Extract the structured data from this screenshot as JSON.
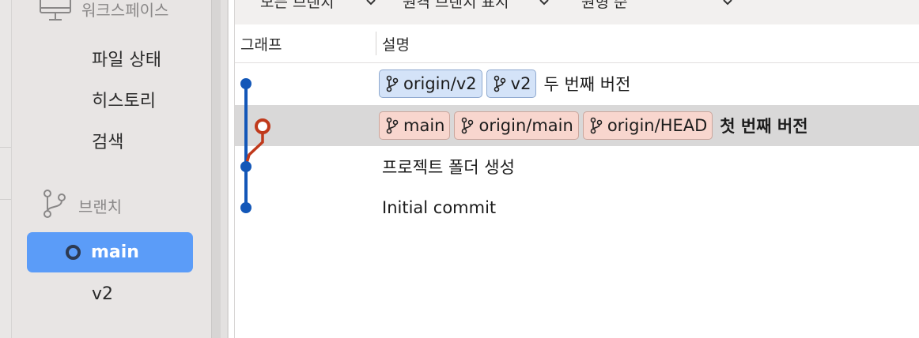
{
  "sidebar": {
    "workspace_label": "워크스페이스",
    "items": [
      {
        "label": "파일 상태"
      },
      {
        "label": "히스토리"
      },
      {
        "label": "검색"
      }
    ],
    "branches_label": "브랜치",
    "branches": [
      {
        "label": "main",
        "active": true
      },
      {
        "label": "v2",
        "active": false
      }
    ]
  },
  "toolbar": {
    "branch_filter": "모든 브랜치",
    "remote_filter": "원격 브랜치 표시",
    "sort_order": "원형 순"
  },
  "columns": {
    "graph": "그래프",
    "description": "설명"
  },
  "commits": [
    {
      "tags": [
        {
          "label": "origin/v2",
          "color": "blue"
        },
        {
          "label": "v2",
          "color": "blue"
        }
      ],
      "message": "두 번째 버전",
      "bold": false,
      "selected": false
    },
    {
      "tags": [
        {
          "label": "main",
          "color": "red"
        },
        {
          "label": "origin/main",
          "color": "red"
        },
        {
          "label": "origin/HEAD",
          "color": "red"
        }
      ],
      "message": "첫 번째 버전",
      "bold": true,
      "selected": true
    },
    {
      "tags": [],
      "message": "프로젝트 폴더 생성",
      "bold": false,
      "selected": false
    },
    {
      "tags": [],
      "message": "Initial commit",
      "bold": false,
      "selected": false
    }
  ],
  "colors": {
    "graph_blue": "#1357b8",
    "graph_red": "#c0391b",
    "active_branch_bg": "#5b9cf8"
  },
  "icons": {
    "workspace": "monitor-icon",
    "branch": "git-branch-icon",
    "dropdown": "chevron-down-icon"
  }
}
